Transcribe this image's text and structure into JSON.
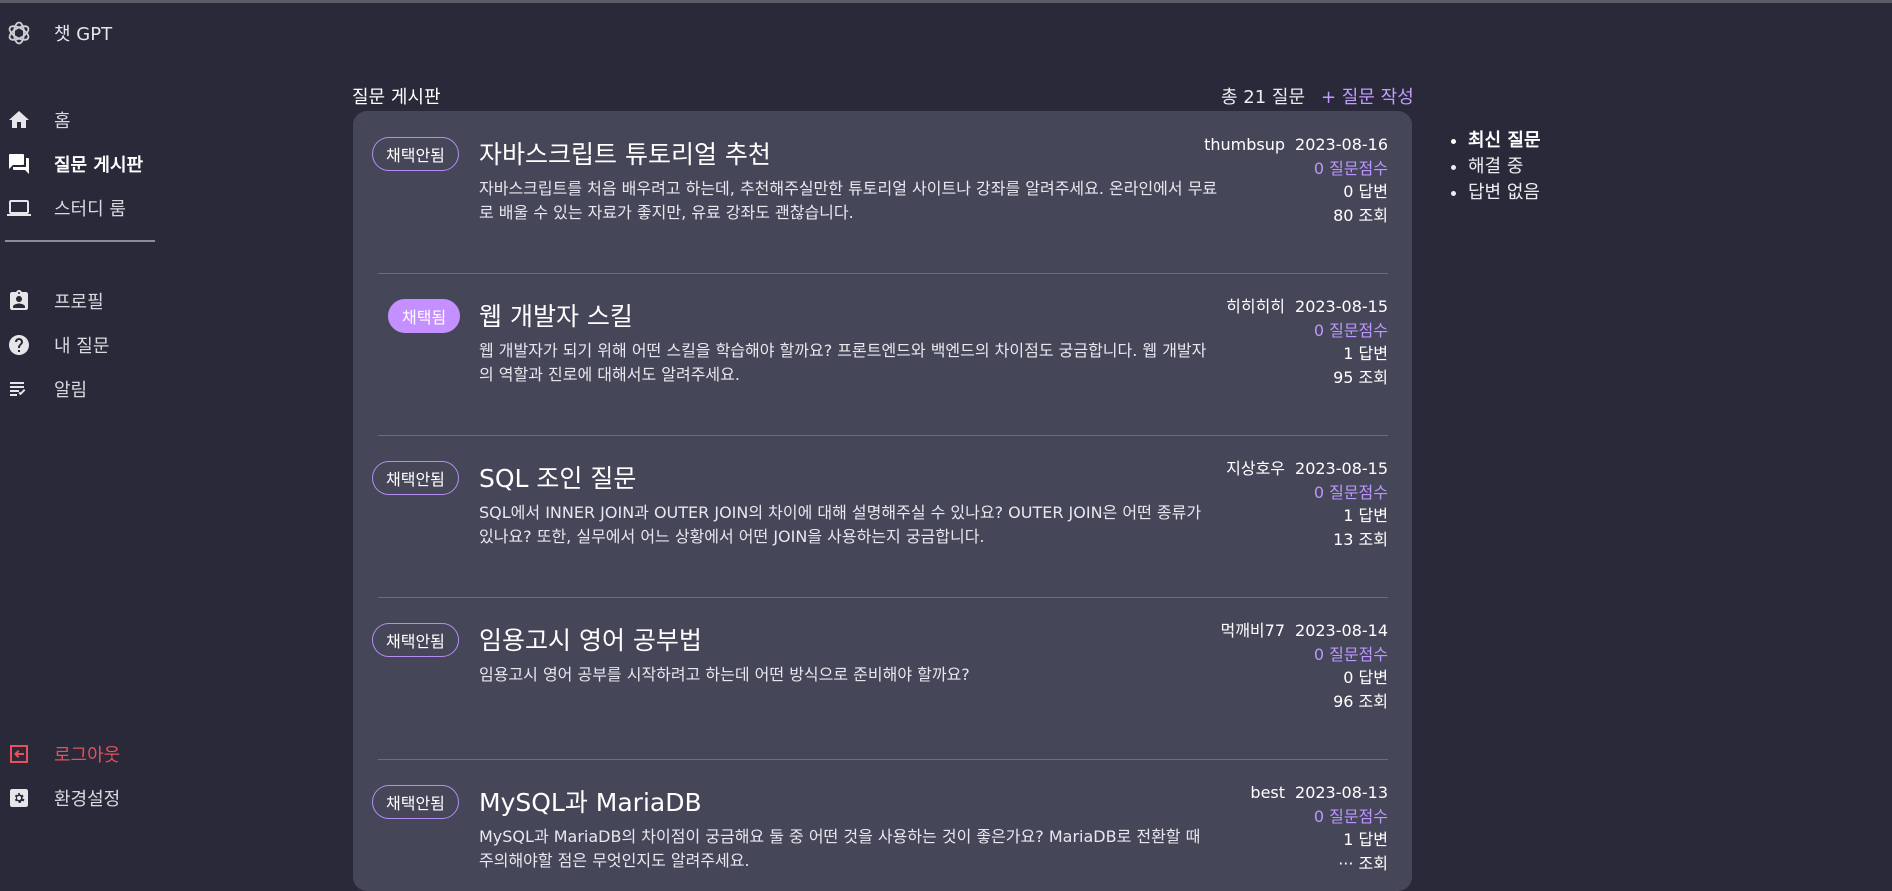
{
  "brand": {
    "title": "챗 GPT",
    "logo_icon": "openai-logo-icon"
  },
  "nav": {
    "main": [
      {
        "label": "홈",
        "icon": "home-icon"
      },
      {
        "label": "질문 게시판",
        "icon": "forum-icon",
        "active": true
      },
      {
        "label": "스터디 룸",
        "icon": "laptop-icon"
      }
    ],
    "user": [
      {
        "label": "프로필",
        "icon": "badge-icon"
      },
      {
        "label": "내 질문",
        "icon": "help-circle-icon"
      },
      {
        "label": "알림",
        "icon": "checklist-icon"
      }
    ],
    "bottom": [
      {
        "label": "로그아웃",
        "icon": "logout-icon"
      },
      {
        "label": "환경설정",
        "icon": "settings-icon"
      }
    ]
  },
  "board": {
    "title": "질문 게시판",
    "count": "총 21 질문",
    "write_label": "+ 질문 작성"
  },
  "questions": [
    {
      "status": "채택안됨",
      "accepted": false,
      "title": "자바스크립트 튜토리얼 추천",
      "body": "자바스크립트를 처음 배우려고 하는데, 추천해주실만한 튜토리얼 사이트나 강좌를 알려주세요. 온라인에서 무료로 배울 수 있는 자료가 좋지만, 유료 강좌도 괜찮습니다.",
      "author": "thumbsup",
      "date": "2023-08-16",
      "score": "0 질문점수",
      "answers": "0 답변",
      "views": "80 조회"
    },
    {
      "status": "채택됨",
      "accepted": true,
      "title": "웹 개발자 스킬",
      "body": "웹 개발자가 되기 위해 어떤 스킬을 학습해야 할까요? 프론트엔드와 백엔드의 차이점도 궁금합니다. 웹 개발자의 역할과 진로에 대해서도 알려주세요.",
      "author": "히히히히",
      "date": "2023-08-15",
      "score": "0 질문점수",
      "answers": "1 답변",
      "views": "95 조회"
    },
    {
      "status": "채택안됨",
      "accepted": false,
      "title": "SQL 조인 질문",
      "body": "SQL에서 INNER JOIN과 OUTER JOIN의 차이에 대해 설명해주실 수 있나요? OUTER JOIN은 어떤 종류가 있나요? 또한, 실무에서 어느 상황에서 어떤 JOIN을 사용하는지 궁금합니다.",
      "author": "지상호우",
      "date": "2023-08-15",
      "score": "0 질문점수",
      "answers": "1 답변",
      "views": "13 조회"
    },
    {
      "status": "채택안됨",
      "accepted": false,
      "title": "임용고시 영어 공부법",
      "body": "임용고시 영어 공부를 시작하려고 하는데 어떤 방식으로 준비해야 할까요?",
      "author": "먹깨비77",
      "date": "2023-08-14",
      "score": "0 질문점수",
      "answers": "0 답변",
      "views": "96 조회"
    },
    {
      "status": "채택안됨",
      "accepted": false,
      "title": "MySQL과 MariaDB",
      "body": "MySQL과 MariaDB의 차이점이 궁금해요 둘 중 어떤 것을 사용하는 것이 좋은가요? MariaDB로 전환할 때 주의해야할 점은 무엇인지도 알려주세요.",
      "author": "best",
      "date": "2023-08-13",
      "score": "0 질문점수",
      "answers": "1 답변",
      "views": "··· 조회"
    }
  ],
  "filters": [
    {
      "label": "최신 질문",
      "active": true
    },
    {
      "label": "해결 중",
      "active": false
    },
    {
      "label": "답변 없음",
      "active": false
    }
  ],
  "colors": {
    "background": "#292939",
    "panel": "#464659",
    "accent": "#c490ff",
    "logout": "#e8505b"
  }
}
